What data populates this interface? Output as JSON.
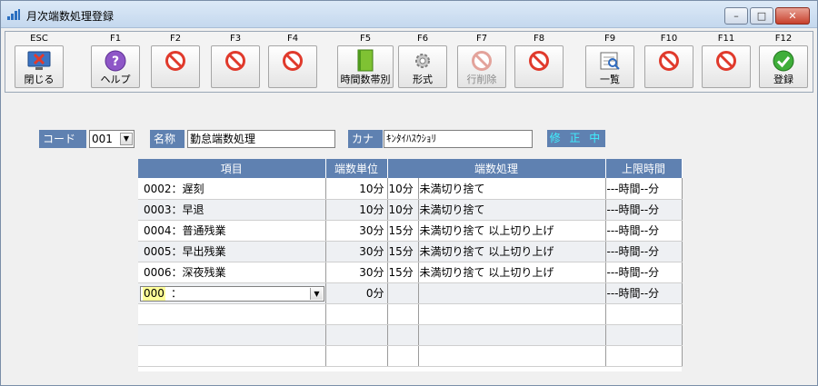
{
  "window": {
    "title": "月次端数処理登録",
    "controls": {
      "minimize": "–",
      "maximize": "□",
      "close": "✕"
    }
  },
  "toolbar": {
    "keys": [
      {
        "key": "ESC",
        "label": "閉じる",
        "icon": "exit-monitor-icon"
      },
      {
        "key": "F1",
        "label": "ヘルプ",
        "icon": "help-icon"
      },
      {
        "key": "F2",
        "label": "",
        "icon": "disabled-icon"
      },
      {
        "key": "F3",
        "label": "",
        "icon": "disabled-icon"
      },
      {
        "key": "F4",
        "label": "",
        "icon": "disabled-icon"
      },
      {
        "key": "F5",
        "label": "時間数帯別",
        "icon": "book-icon"
      },
      {
        "key": "F6",
        "label": "形式",
        "icon": "gear-icon"
      },
      {
        "key": "F7",
        "label": "行削除",
        "icon": "delete-row-icon",
        "disabled": true
      },
      {
        "key": "F8",
        "label": "",
        "icon": "disabled-icon"
      },
      {
        "key": "F9",
        "label": "一覧",
        "icon": "list-view-icon"
      },
      {
        "key": "F10",
        "label": "",
        "icon": "disabled-icon"
      },
      {
        "key": "F11",
        "label": "",
        "icon": "disabled-icon"
      },
      {
        "key": "F12",
        "label": "登録",
        "icon": "check-icon"
      }
    ]
  },
  "form": {
    "code_label": "コード",
    "code_value": "001",
    "name_label": "名称",
    "name_value": "勤怠端数処理",
    "kana_label": "カナ",
    "kana_value": "ｷﾝﾀｲﾊｽｳｼｮﾘ",
    "status": "修 正 中"
  },
  "grid": {
    "columns": [
      "項目",
      "端数単位",
      "端数処理",
      "上限時間"
    ],
    "rows": [
      {
        "item": "0002：遅刻",
        "unit": "10分",
        "proc_unit": "10分",
        "proc": "未満切り捨て",
        "limit": "---時間--分"
      },
      {
        "item": "0003：早退",
        "unit": "10分",
        "proc_unit": "10分",
        "proc": "未満切り捨て",
        "limit": "---時間--分"
      },
      {
        "item": "0004：普通残業",
        "unit": "30分",
        "proc_unit": "15分",
        "proc": "未満切り捨て 以上切り上げ",
        "limit": "---時間--分"
      },
      {
        "item": "0005：早出残業",
        "unit": "30分",
        "proc_unit": "15分",
        "proc": "未満切り捨て 以上切り上げ",
        "limit": "---時間--分"
      },
      {
        "item": "0006：深夜残業",
        "unit": "30分",
        "proc_unit": "15分",
        "proc": "未満切り捨て 以上切り上げ",
        "limit": "---時間--分"
      }
    ],
    "edit_row": {
      "code": "000",
      "separator": "：",
      "unit": "0分",
      "limit": "---時間--分"
    }
  },
  "colors": {
    "header_blue": "#5f81b1",
    "status_text": "#3ff0ff",
    "edit_highlight": "#ffff99"
  }
}
